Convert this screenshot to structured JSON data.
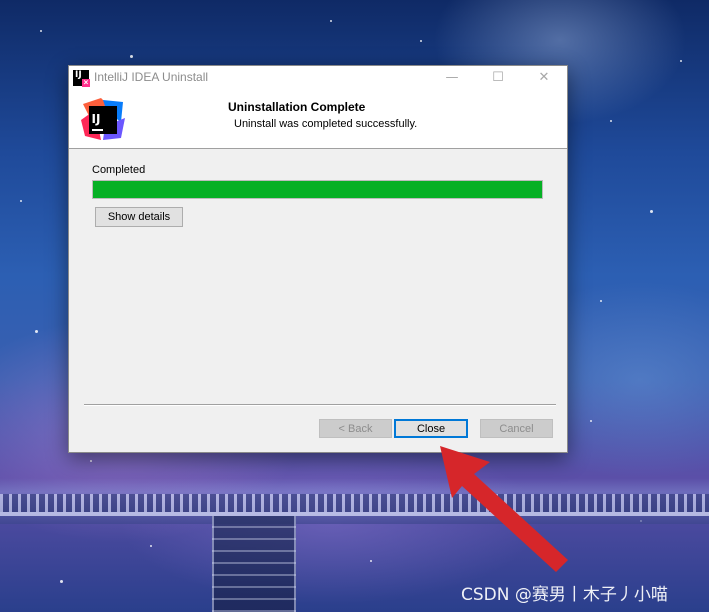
{
  "window": {
    "title": "IntelliJ IDEA Uninstall",
    "title_icon_glyph": "IJ",
    "title_icon_badge": "×",
    "caption_minimize": "—",
    "caption_maximize": "☐",
    "caption_close": "✕"
  },
  "header": {
    "title": "Uninstallation Complete",
    "subtitle": "Uninstall was completed successfully.",
    "logo_text": "IJ"
  },
  "body": {
    "status_label": "Completed",
    "progress_percent": 100,
    "progress_color": "#06b025",
    "show_details_label": "Show details"
  },
  "footer": {
    "back_label": "< Back",
    "close_label": "Close",
    "cancel_label": "Cancel"
  },
  "annotation": {
    "arrow_color": "#d6262a"
  },
  "watermark": {
    "text": "CSDN @赛男丨木子丿小喵"
  },
  "icons": {
    "app_icon": "intellij-idea-icon",
    "logo": "intellij-idea-logo"
  }
}
